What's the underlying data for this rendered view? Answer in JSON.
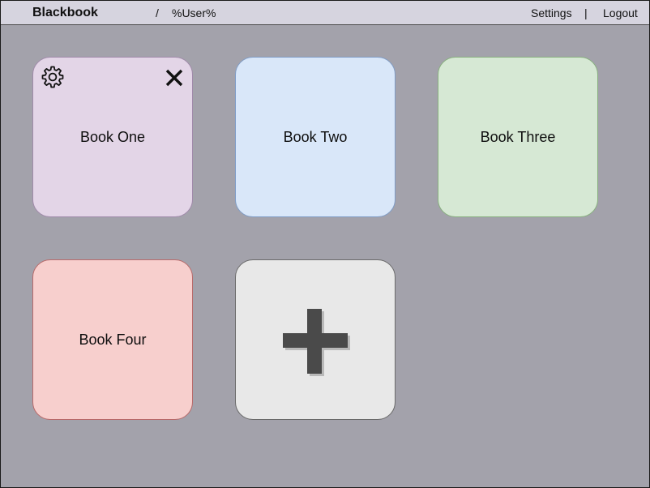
{
  "header": {
    "app_title": "Blackbook",
    "breadcrumb_separator": "/",
    "user": "%User%",
    "settings_label": "Settings",
    "nav_separator": "|",
    "logout_label": "Logout"
  },
  "books": [
    {
      "label": "Book One",
      "color": "#e3d5e7",
      "has_settings_icon": true,
      "has_close_icon": true
    },
    {
      "label": "Book Two",
      "color": "#d9e7f9"
    },
    {
      "label": "Book Three",
      "color": "#d6e8d4"
    },
    {
      "label": "Book Four",
      "color": "#f7cfcd"
    }
  ],
  "add_tile": {
    "icon": "plus-icon",
    "color": "#e8e8e8"
  },
  "colors": {
    "background": "#a3a2ab",
    "header": "#d6d4df"
  },
  "icons": [
    "gear-icon",
    "close-icon",
    "plus-icon"
  ]
}
